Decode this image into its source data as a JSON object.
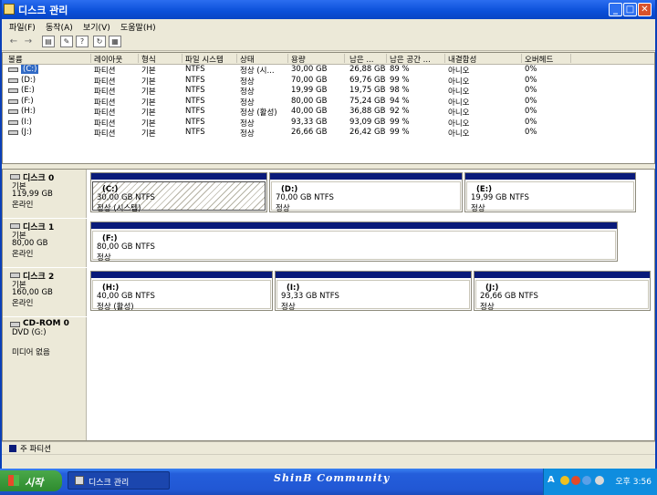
{
  "window": {
    "title": "디스크 관리"
  },
  "menu": [
    "파일(F)",
    "동작(A)",
    "보기(V)",
    "도움말(H)"
  ],
  "columns": [
    "볼륨",
    "레이아웃",
    "형식",
    "파일 시스템",
    "상태",
    "용량",
    "남은 ...",
    "남은 공간 ...",
    "내결함성",
    "오버헤드"
  ],
  "volumes": [
    {
      "name": "(C:)",
      "layout": "파티션",
      "type": "기본",
      "fs": "NTFS",
      "status": "정상 (시...",
      "capacity": "30,00 GB",
      "free": "26,88 GB",
      "pct": "89 %",
      "ft": "아니오",
      "overhead": "0%"
    },
    {
      "name": "(D:)",
      "layout": "파티션",
      "type": "기본",
      "fs": "NTFS",
      "status": "정상",
      "capacity": "70,00 GB",
      "free": "69,76 GB",
      "pct": "99 %",
      "ft": "아니오",
      "overhead": "0%"
    },
    {
      "name": "(E:)",
      "layout": "파티션",
      "type": "기본",
      "fs": "NTFS",
      "status": "정상",
      "capacity": "19,99 GB",
      "free": "19,75 GB",
      "pct": "98 %",
      "ft": "아니오",
      "overhead": "0%"
    },
    {
      "name": "(F:)",
      "layout": "파티션",
      "type": "기본",
      "fs": "NTFS",
      "status": "정상",
      "capacity": "80,00 GB",
      "free": "75,24 GB",
      "pct": "94 %",
      "ft": "아니오",
      "overhead": "0%"
    },
    {
      "name": "(H:)",
      "layout": "파티션",
      "type": "기본",
      "fs": "NTFS",
      "status": "정상 (활성)",
      "capacity": "40,00 GB",
      "free": "36,88 GB",
      "pct": "92 %",
      "ft": "아니오",
      "overhead": "0%"
    },
    {
      "name": "(I:)",
      "layout": "파티션",
      "type": "기본",
      "fs": "NTFS",
      "status": "정상",
      "capacity": "93,33 GB",
      "free": "93,09 GB",
      "pct": "99 %",
      "ft": "아니오",
      "overhead": "0%"
    },
    {
      "name": "(J:)",
      "layout": "파티션",
      "type": "기본",
      "fs": "NTFS",
      "status": "정상",
      "capacity": "26,66 GB",
      "free": "26,42 GB",
      "pct": "99 %",
      "ft": "아니오",
      "overhead": "0%"
    }
  ],
  "disks": [
    {
      "name": "디스크 0",
      "type": "기본",
      "size": "119,99 GB",
      "state": "온라인",
      "partitions": [
        {
          "letter": "(C:)",
          "info": "30,00 GB NTFS",
          "status": "정상 (시스템)",
          "selected": true
        },
        {
          "letter": "(D:)",
          "info": "70,00 GB NTFS",
          "status": "정상"
        },
        {
          "letter": "(E:)",
          "info": "19,99 GB NTFS",
          "status": "정상"
        }
      ]
    },
    {
      "name": "디스크 1",
      "type": "기본",
      "size": "80,00 GB",
      "state": "온라인",
      "partitions": [
        {
          "letter": "(F:)",
          "info": "80,00 GB NTFS",
          "status": "정상"
        }
      ]
    },
    {
      "name": "디스크 2",
      "type": "기본",
      "size": "160,00 GB",
      "state": "온라인",
      "partitions": [
        {
          "letter": "(H:)",
          "info": "40,00 GB NTFS",
          "status": "정상 (활성)"
        },
        {
          "letter": "(I:)",
          "info": "93,33 GB NTFS",
          "status": "정상"
        },
        {
          "letter": "(J:)",
          "info": "26,66 GB NTFS",
          "status": "정상"
        }
      ]
    },
    {
      "name": "CD-ROM 0",
      "type": "DVD (G:)",
      "size": "",
      "state": "미디어 없음",
      "partitions": []
    }
  ],
  "legend": "주 파티션",
  "taskbar": {
    "start": "시작",
    "task": "디스크 관리",
    "brand": "ShinB  Community",
    "lang": "A",
    "clock": "오후 3:56"
  },
  "colors": {
    "partition_bar": "#0a1b7a",
    "taskbar": "#245edb",
    "selection": "#316ac5"
  }
}
